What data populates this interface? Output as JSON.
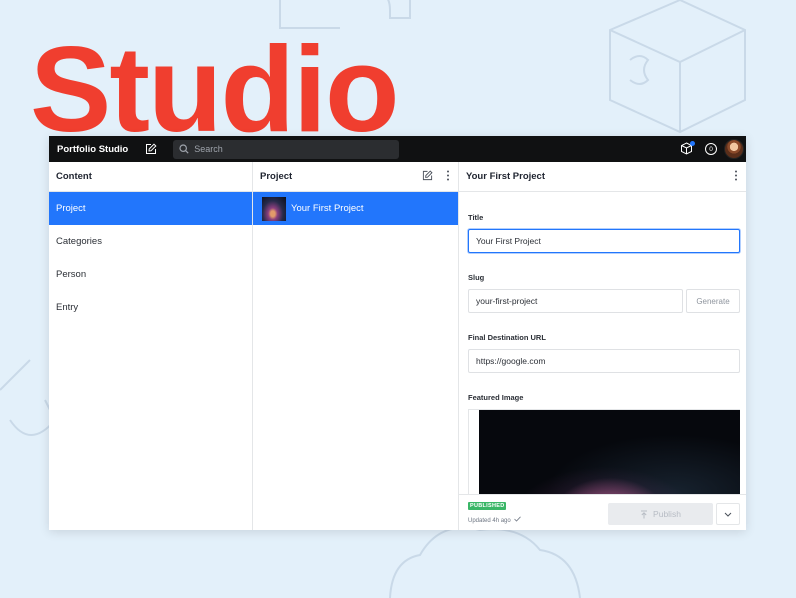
{
  "hero": {
    "title": "Studio"
  },
  "topbar": {
    "brand": "Portfolio Studio",
    "search_placeholder": "Search",
    "notification_count": "0"
  },
  "content_pane": {
    "title": "Content",
    "items": [
      {
        "label": "Project",
        "active": true
      },
      {
        "label": "Categories",
        "active": false
      },
      {
        "label": "Person",
        "active": false
      },
      {
        "label": "Entry",
        "active": false
      }
    ]
  },
  "project_pane": {
    "title": "Project",
    "documents": [
      {
        "label": "Your First Project",
        "active": true
      }
    ]
  },
  "document_pane": {
    "title": "Your First Project",
    "fields": {
      "title_label": "Title",
      "title_value": "Your First Project",
      "slug_label": "Slug",
      "slug_value": "your-first-project",
      "generate_label": "Generate",
      "url_label": "Final Destination URL",
      "url_value": "https://google.com",
      "image_label": "Featured Image"
    },
    "footer": {
      "status": "PUBLISHED",
      "updated": "Updated 4h ago",
      "publish_label": "Publish"
    }
  },
  "colors": {
    "accent": "#2276fc",
    "brand_red": "#f03e2f",
    "topbar": "#101112",
    "background": "#e3f0fa",
    "published": "#3ab667"
  }
}
